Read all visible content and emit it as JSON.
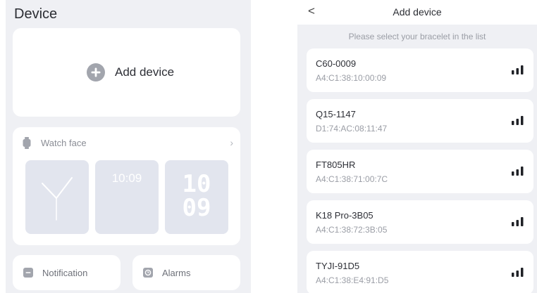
{
  "left": {
    "title": "Device",
    "add_device_label": "Add device",
    "watch_face": {
      "title": "Watch face",
      "faces": [
        {
          "type": "analog"
        },
        {
          "type": "digital",
          "time": "10:09"
        },
        {
          "type": "big-digits",
          "hours": "10",
          "minutes": "09"
        }
      ]
    },
    "notification_label": "Notification",
    "alarms_label": "Alarms"
  },
  "right": {
    "title": "Add device",
    "hint": "Please select your bracelet in the list",
    "devices": [
      {
        "name": "C60-0009",
        "mac": "A4:C1:38:10:00:09"
      },
      {
        "name": "Q15-1147",
        "mac": "D1:74:AC:08:11:47"
      },
      {
        "name": "FT805HR",
        "mac": "A4:C1:38:71:00:7C"
      },
      {
        "name": "K18 Pro-3B05",
        "mac": "A4:C1:38:72:3B:05"
      },
      {
        "name": "TYJI-91D5",
        "mac": "A4:C1:38:E4:91:D5"
      }
    ]
  },
  "colors": {
    "background": "#eff0f4",
    "card": "#ffffff",
    "face": "#e2e5ee",
    "icon_gray": "#9ea1a8",
    "signal": "#1f2126"
  },
  "icons": {
    "add": "plus-circle-icon",
    "watch": "watch-icon",
    "chevron": "chevron-right-icon",
    "back": "chevron-left-icon",
    "notification": "message-icon",
    "alarm": "clock-icon",
    "signal": "signal-strength-icon"
  }
}
